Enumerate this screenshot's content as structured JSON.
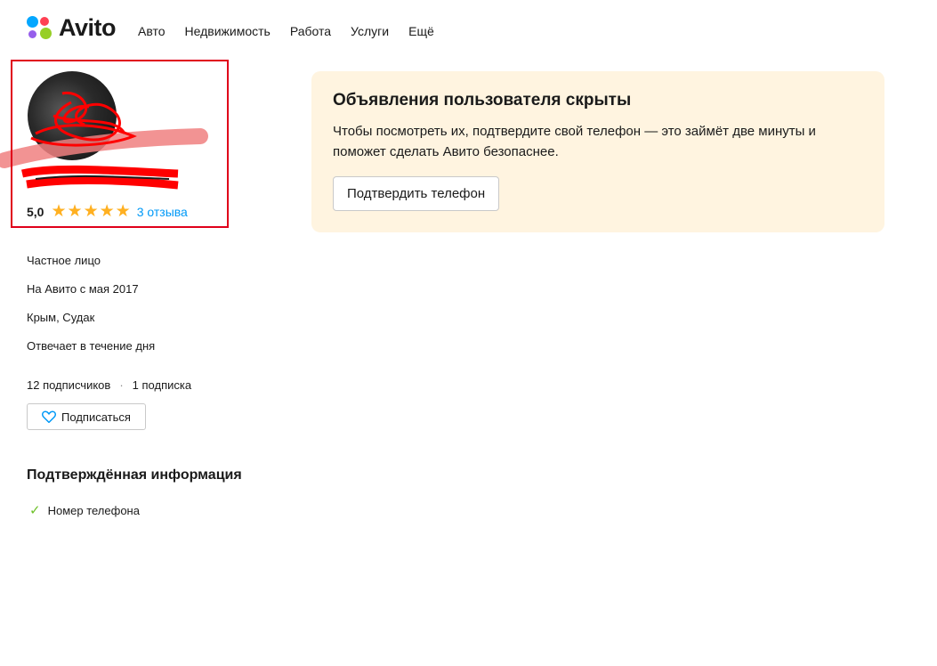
{
  "header": {
    "logo_text": "Avito",
    "nav": [
      "Авто",
      "Недвижимость",
      "Работа",
      "Услуги",
      "Ещё"
    ]
  },
  "profile": {
    "rating": "5,0",
    "stars": 5,
    "reviews_link": "3 отзыва",
    "type": "Частное лицо",
    "since": "На Авито с мая 2017",
    "location": "Крым, Судак",
    "response": "Отвечает в течение дня",
    "subscribers": "12 подписчиков",
    "separator": "·",
    "subscriptions": "1 подписка",
    "subscribe_button": "Подписаться"
  },
  "verified": {
    "title": "Подтверждённая информация",
    "items": [
      "Номер телефона"
    ]
  },
  "notice": {
    "title": "Объявления пользователя скрыты",
    "text": "Чтобы посмотреть их, подтвердите свой телефон — это займёт две минуты и поможет сделать Авито безопаснее.",
    "button": "Подтвердить телефон"
  },
  "colors": {
    "accent_link": "#0099f7",
    "star": "#ffb021",
    "check": "#6ec12a",
    "notice_bg": "#fff4e0",
    "highlight": "#e0001a"
  }
}
